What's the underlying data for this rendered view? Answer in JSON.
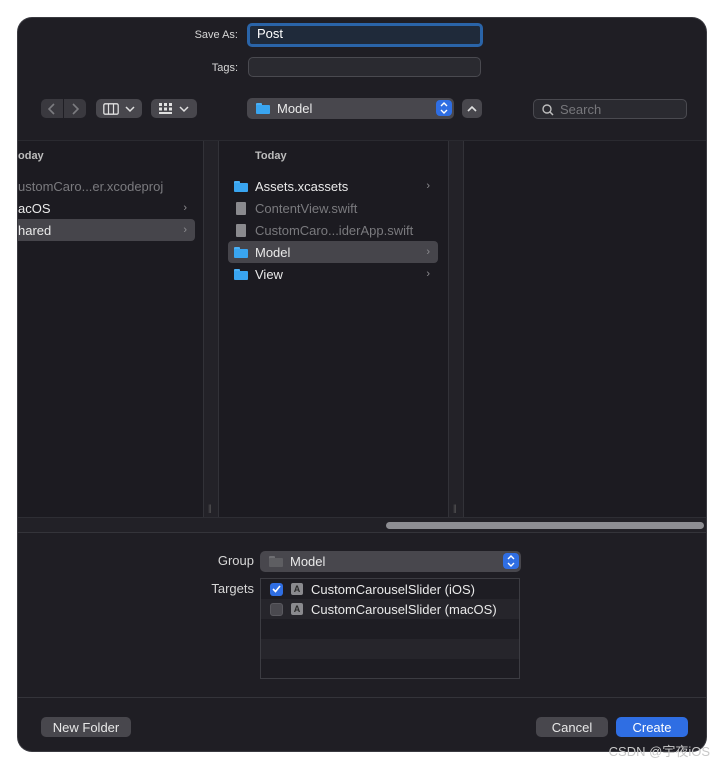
{
  "save_as": {
    "label": "Save As:",
    "value": "Post"
  },
  "tags": {
    "label": "Tags:",
    "value": ""
  },
  "toolbar": {
    "back_icon": "chevron-left-icon",
    "forward_icon": "chevron-right-icon",
    "view_icon": "columns-view-icon",
    "group_icon": "grid-group-icon",
    "location": "Model",
    "expand_icon": "chevron-up-icon",
    "search_placeholder": "Search"
  },
  "columns": [
    {
      "header": "oday",
      "items": [
        {
          "label": "ustomCaro...er.xcodeproj",
          "kind": "file",
          "dim": true,
          "chevron": false
        },
        {
          "label": "acOS",
          "kind": "folder",
          "dim": false,
          "chevron": true
        },
        {
          "label": "hared",
          "kind": "folder",
          "dim": false,
          "chevron": true,
          "selected": true
        }
      ]
    },
    {
      "header": "Today",
      "items": [
        {
          "label": "Assets.xcassets",
          "kind": "folder",
          "dim": false,
          "chevron": true
        },
        {
          "label": "ContentView.swift",
          "kind": "file",
          "dim": true,
          "chevron": false
        },
        {
          "label": "CustomCaro...iderApp.swift",
          "kind": "file",
          "dim": true,
          "chevron": false
        },
        {
          "label": "Model",
          "kind": "folder",
          "dim": false,
          "chevron": true,
          "selected": true
        },
        {
          "label": "View",
          "kind": "folder",
          "dim": false,
          "chevron": true
        }
      ]
    }
  ],
  "group": {
    "label": "Group",
    "value": "Model"
  },
  "targets": {
    "label": "Targets",
    "items": [
      {
        "label": "CustomCarouselSlider (iOS)",
        "checked": true
      },
      {
        "label": "CustomCarouselSlider (macOS)",
        "checked": false
      }
    ]
  },
  "buttons": {
    "new_folder": "New Folder",
    "cancel": "Cancel",
    "create": "Create"
  },
  "colors": {
    "accent": "#2f6ee3",
    "folder": "#39a5f0",
    "background": "#1f1e24"
  },
  "watermark": "CSDN @宇夜iOS"
}
